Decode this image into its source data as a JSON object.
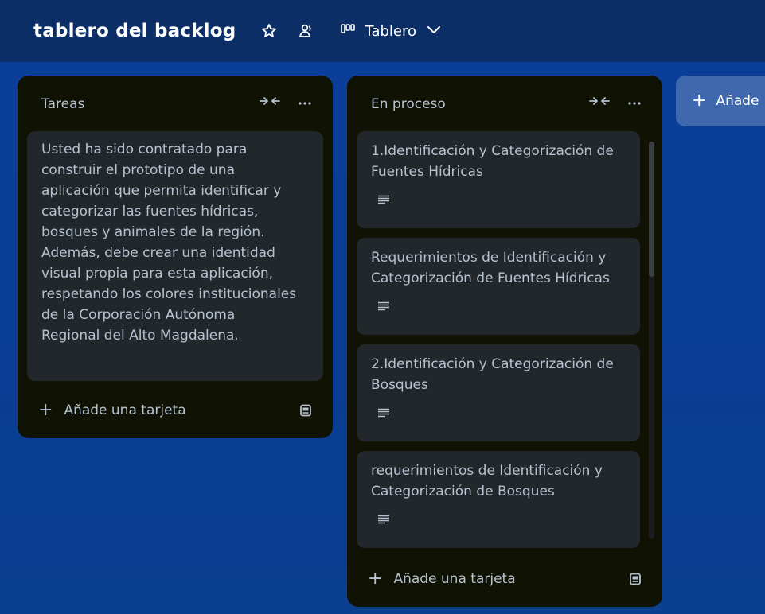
{
  "board": {
    "title": "tablero del backlog",
    "view_label": "Tablero",
    "icons": [
      "star-icon",
      "members-icon",
      "board-view-icon",
      "chevron-down-icon"
    ]
  },
  "lists": [
    {
      "title": "Tareas",
      "cards": [
        {
          "text": "Usted ha sido contratado para construir el prototipo de una aplicación que permita identificar y categorizar las fuentes hídricas, bosques y animales de la región. Además, debe crear una identidad visual propia para esta aplicación, respetando los colores institucionales de la Corporación Autónoma Regional del Alto Magdalena.",
          "lines": [
            "Usted ha sido contratado para",
            "construir el prototipo de una",
            "aplicación que permita identificar y",
            "categorizar las fuentes hídricas,",
            "bosques y animales de la región.",
            "Además, debe crear una identidad",
            "visual propia para esta aplicación,",
            "respetando los colores institucionales",
            "de la Corporación Autónoma",
            "Regional del Alto Magdalena."
          ]
        }
      ],
      "add_card_label": "Añade una tarjeta"
    },
    {
      "title": "En proceso",
      "cards": [
        {
          "lines": [
            "1.Identificación y Categorización de",
            "Fuentes Hídricas"
          ],
          "has_description": true
        },
        {
          "lines": [
            "Requerimientos de Identificación y",
            "Categorización de Fuentes Hídricas"
          ],
          "has_description": true
        },
        {
          "lines": [
            "2.Identificación y Categorización de",
            "Bosques"
          ],
          "has_description": true
        },
        {
          "lines": [
            "requerimientos de Identificación y",
            "Categorización de Bosques"
          ],
          "has_description": true
        }
      ],
      "add_card_label": "Añade una tarjeta"
    }
  ],
  "add_list_label": "Añade"
}
